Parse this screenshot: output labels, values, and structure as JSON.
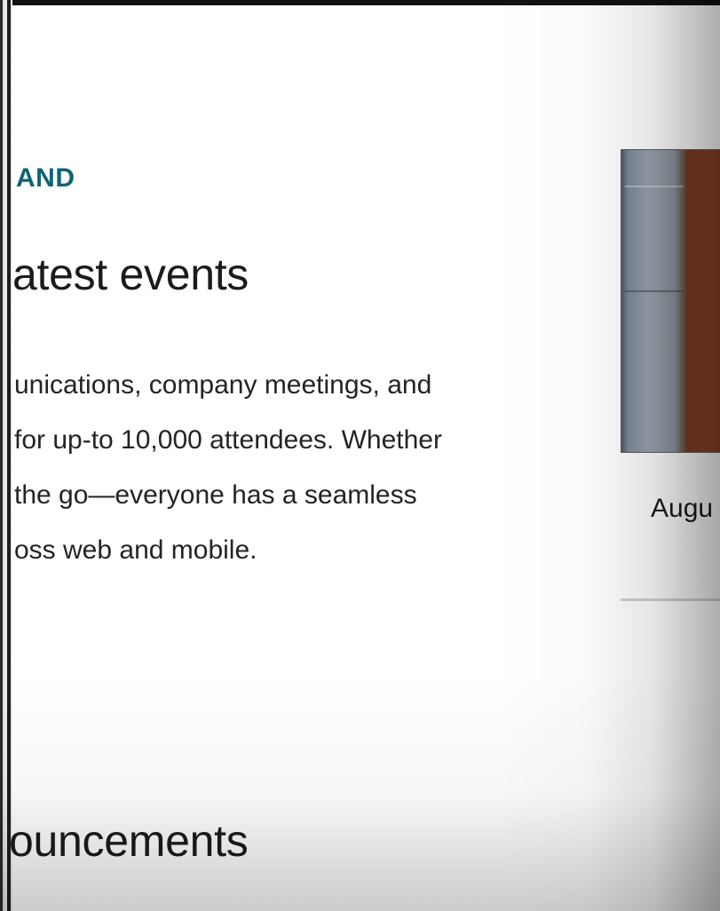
{
  "hero": {
    "eyebrow": "AND",
    "heading": "atest events",
    "description_lines": [
      "unications, company meetings, and",
      "for up-to 10,000 attendees. Whether",
      "the go—everyone has a seamless",
      "oss web and mobile."
    ]
  },
  "event_card": {
    "date": "Augu"
  },
  "announcements": {
    "heading": "ouncements"
  },
  "colors": {
    "accent_teal": "#0f6470",
    "text": "#1b1b1b"
  }
}
